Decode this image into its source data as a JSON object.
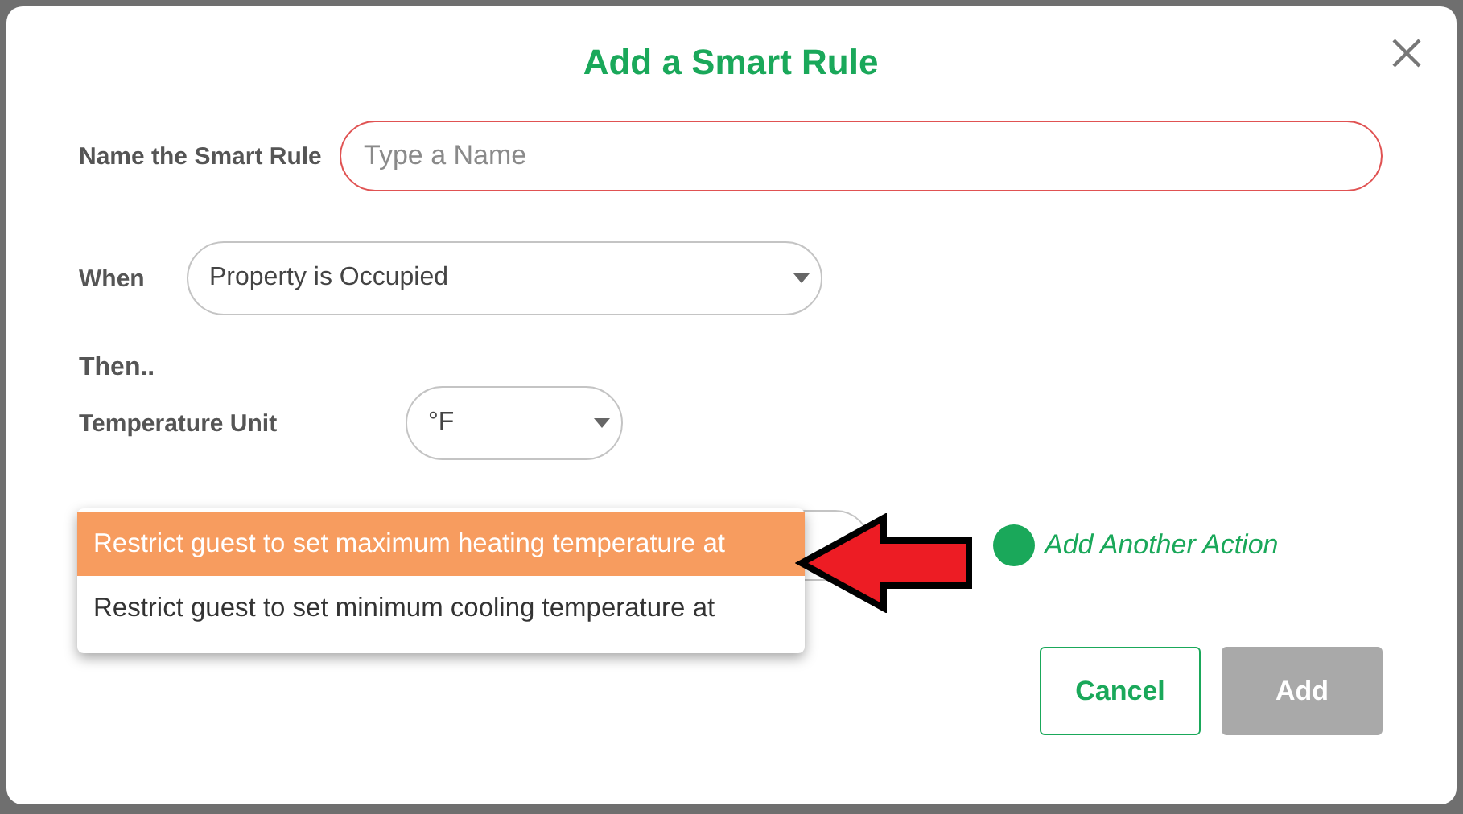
{
  "dialog": {
    "title": "Add a Smart Rule"
  },
  "name_field": {
    "label": "Name the Smart Rule",
    "placeholder": "Type a Name"
  },
  "when": {
    "label": "When",
    "value": "Property is Occupied"
  },
  "then_label": "Then..",
  "temperature_unit": {
    "label": "Temperature Unit",
    "value": "°F"
  },
  "action_menu": {
    "options": [
      {
        "label": "Restrict guest to set maximum heating temperature at",
        "selected": true
      },
      {
        "label": "Restrict guest to set minimum cooling temperature at",
        "selected": false
      }
    ]
  },
  "add_action_link": "Add Another Action",
  "buttons": [
    {
      "label": "Cancel",
      "kind": "secondary",
      "disabled": false
    },
    {
      "label": "Add",
      "kind": "primary",
      "disabled": true
    }
  ]
}
